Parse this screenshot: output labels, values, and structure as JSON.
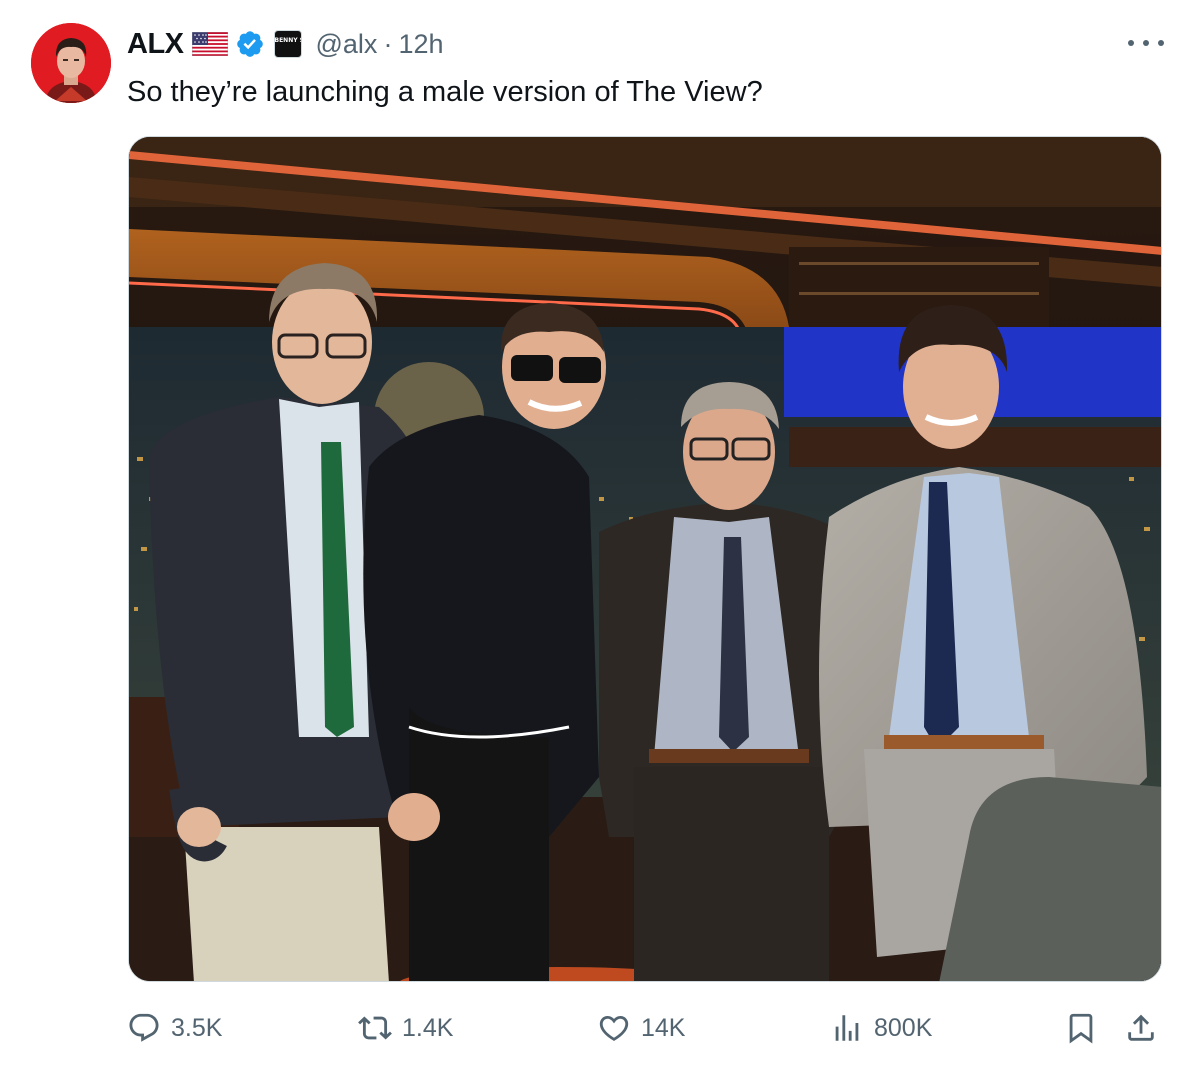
{
  "tweet": {
    "display_name": "ALX",
    "handle": "@alx",
    "separator": "·",
    "time": "12h",
    "affiliate_badge_text": "BENNY SHOW",
    "text": "So they’re launching a male version of The View?"
  },
  "icons": {
    "more": "more-horizontal-icon",
    "flag": "us-flag-icon",
    "verified": "verified-badge-icon",
    "reply": "reply-icon",
    "retweet": "retweet-icon",
    "like": "heart-icon",
    "views": "views-icon",
    "bookmark": "bookmark-icon",
    "share": "share-icon"
  },
  "metrics": {
    "replies": "3.5K",
    "reposts": "1.4K",
    "likes": "14K",
    "views": "800K"
  },
  "colors": {
    "verified": "#1d9bf0",
    "secondary_text": "#536471",
    "primary_text": "#0f1419",
    "avatar_bg": "#e01b22"
  }
}
